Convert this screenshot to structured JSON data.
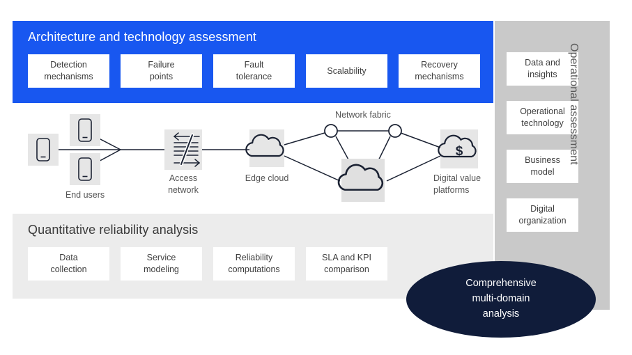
{
  "architecture": {
    "title": "Architecture and technology assessment",
    "accent_color": "#1857f0",
    "items": [
      {
        "label": "Detection\nmechanisms"
      },
      {
        "label": "Failure\npoints"
      },
      {
        "label": "Fault\ntolerance"
      },
      {
        "label": "Scalability"
      },
      {
        "label": "Recovery\nmechanisms"
      }
    ]
  },
  "quantitative": {
    "title": "Quantitative reliability analysis",
    "panel_color": "#ececec",
    "items": [
      {
        "label": "Data\ncollection"
      },
      {
        "label": "Service\nmodeling"
      },
      {
        "label": "Reliability\ncomputations"
      },
      {
        "label": "SLA and KPI\ncomparison"
      }
    ]
  },
  "operational": {
    "title": "Operational assessment",
    "panel_color": "#c9c9c9",
    "items": [
      {
        "label": "Data and\ninsights"
      },
      {
        "label": "Operational\ntechnology"
      },
      {
        "label": "Business\nmodel"
      },
      {
        "label": "Digital\norganization"
      }
    ]
  },
  "diagram": {
    "nodes": [
      {
        "id": "end-users",
        "label": "End users",
        "icon": "mobile-phone-icon"
      },
      {
        "id": "access-network",
        "label": "Access\nnetwork",
        "icon": "network-exchange-icon"
      },
      {
        "id": "edge-cloud",
        "label": "Edge cloud",
        "icon": "cloud-icon"
      },
      {
        "id": "network-fabric",
        "label": "Network fabric",
        "icon": "network-node-icon"
      },
      {
        "id": "digital-value-platforms",
        "label": "Digital value\nplatforms",
        "icon": "cloud-dollar-icon"
      }
    ]
  },
  "callout": {
    "label": "Comprehensive\nmulti-domain\nanalysis",
    "color": "#101c3a"
  }
}
